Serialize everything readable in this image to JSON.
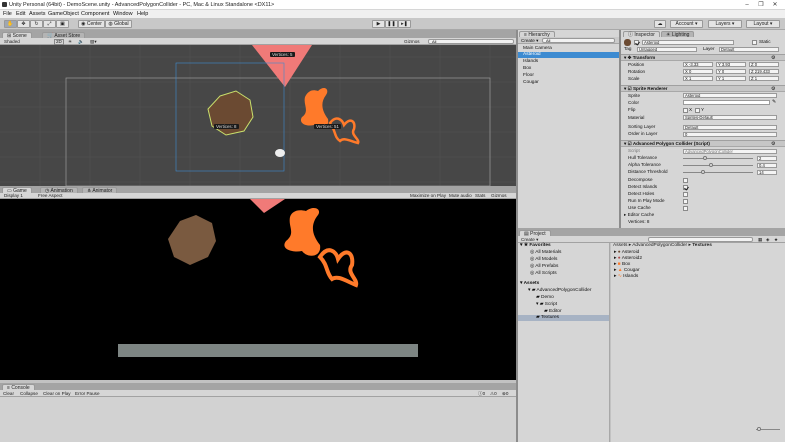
{
  "window": {
    "title": "Unity Personal (64bit) - DemoScene.unity - AdvancedPolygonCollider - PC, Mac & Linux Standalone <DX11>",
    "controls": [
      "–",
      "❐",
      "✕"
    ]
  },
  "menu": [
    "File",
    "Edit",
    "Assets",
    "GameObject",
    "Component",
    "Window",
    "Help"
  ],
  "toolbar": {
    "center_label": "Center",
    "global_label": "Global",
    "account_label": "Account",
    "layers_label": "Layers",
    "layout_label": "Layout"
  },
  "scene": {
    "tab_scene": "Scene",
    "tab_asset_store": "Asset Store",
    "shaded": "Shaded",
    "mode_2d": "2D",
    "gizmos": "Gizmos",
    "search": "All",
    "vertex_labels": [
      "Vertices: 5",
      "Vertices: 8",
      "Vertices: 51"
    ]
  },
  "game": {
    "tab_game": "Game",
    "tab_animation": "Animation",
    "tab_animator": "Animator",
    "display": "Display 1",
    "aspect": "Free Aspect",
    "options": [
      "Maximize on Play",
      "Mute audio",
      "Stats",
      "Gizmos"
    ]
  },
  "console": {
    "tab": "Console",
    "buttons": [
      "Clear",
      "Collapse",
      "Clear on Play",
      "Error Pause"
    ],
    "counts": [
      "0",
      "0",
      "0"
    ]
  },
  "hierarchy": {
    "tab": "Hierarchy",
    "create": "Create",
    "search": "All",
    "items": [
      "Main Camera",
      "Asteroid",
      "Islands",
      "Box",
      "Floor",
      "Cougar"
    ],
    "selected_index": 1
  },
  "inspector": {
    "tab_inspector": "Inspector",
    "tab_lighting": "Lighting",
    "object_name": "Asteroid",
    "static_label": "Static",
    "tag_label": "Tag",
    "tag_value": "Untagged",
    "layer_label": "Layer",
    "layer_value": "Default",
    "transform": {
      "title": "Transform",
      "position_label": "Position",
      "rotation_label": "Rotation",
      "scale_label": "Scale",
      "position": [
        "X -3.33",
        "Y 3.93",
        "Z 0"
      ],
      "rotation": [
        "X 0",
        "Y 0",
        "Z 219.433"
      ],
      "scale": [
        "X 1",
        "Y 1",
        "Z 1"
      ]
    },
    "sprite_renderer": {
      "title": "Sprite Renderer",
      "sprite_label": "Sprite",
      "sprite_value": "Asteroid",
      "color_label": "Color",
      "flip_label": "Flip",
      "flip_x": "X",
      "flip_y": "Y",
      "material_label": "Material",
      "material_value": "Sprites-Default",
      "sorting_layer_label": "Sorting Layer",
      "sorting_layer_value": "Default",
      "order_label": "Order in Layer",
      "order_value": "0"
    },
    "collider": {
      "title": "Advanced Polygon Collider (Script)",
      "script_label": "Script",
      "script_value": "AdvancedPolygonCollider",
      "hull_label": "Hull Tolerance",
      "hull_value": "2",
      "hull_fraction": 0.3,
      "alpha_label": "Alpha Tolerance",
      "alpha_value": "0.4",
      "alpha_fraction": 0.4,
      "distance_label": "Distance Threshold",
      "distance_value": "14",
      "distance_fraction": 0.28,
      "decompose_label": "Decompose",
      "decompose": false,
      "islands_label": "Detect Islands",
      "islands": true,
      "holes_label": "Detect Holes",
      "holes": false,
      "runplay_label": "Run In Play Mode",
      "runplay": false,
      "cache_label": "Use Cache",
      "cache": false,
      "editor_cache_label": "Editor Cache",
      "vertices_label": "Vertices: 8"
    }
  },
  "project": {
    "tab": "Project",
    "create": "Create",
    "favorites_label": "Favorites",
    "favorites": [
      "All Materials",
      "All Models",
      "All Prefabs",
      "All Scripts"
    ],
    "assets_label": "Assets",
    "tree": [
      "AdvancedPolygonCollider",
      "Demo",
      "Script",
      "Editor",
      "Textures"
    ],
    "breadcrumb": [
      "Assets",
      "AdvancedPolygonCollider",
      "Textures"
    ],
    "files": [
      "Asteroid",
      "Asteroid2",
      "Box",
      "Cougar",
      "Islands"
    ]
  },
  "colors": {
    "scene_bg": "#474747",
    "game_bg": "#000000",
    "orange": "#ff7a2a",
    "pink": "#f07a78",
    "selection": "#3d8bd1"
  }
}
